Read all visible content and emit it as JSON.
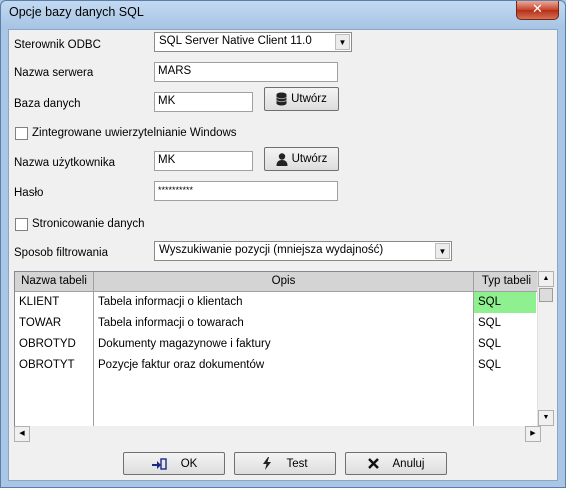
{
  "window": {
    "title": "Opcje bazy danych SQL",
    "close_glyph": "✕"
  },
  "form": {
    "driver_label": "Sterownik ODBC",
    "driver_value": "SQL Server Native Client 11.0",
    "server_label": "Nazwa serwera",
    "server_value": "MARS",
    "database_label": "Baza danych",
    "database_value": "MK",
    "create_db_label": "Utwórz",
    "integrated_auth_label": "Zintegrowane uwierzytelnianie Windows",
    "integrated_auth_checked": false,
    "username_label": "Nazwa użytkownika",
    "username_value": "MK",
    "create_user_label": "Utwórz",
    "password_label": "Hasło",
    "password_value": "**********",
    "paging_label": "Stronicowanie danych",
    "paging_checked": false,
    "filter_label": "Sposob filtrowania",
    "filter_value": "Wyszukiwanie pozycji (mniejsza wydajność)"
  },
  "table": {
    "columns": [
      "Nazwa tabeli",
      "Opis",
      "Typ tabeli"
    ],
    "rows": [
      {
        "name": "KLIENT",
        "desc": "Tabela informacji o klientach",
        "type": "SQL",
        "highlight_type": true
      },
      {
        "name": "TOWAR",
        "desc": "Tabela informacji o towarach",
        "type": "SQL",
        "highlight_type": false
      },
      {
        "name": "OBROTYD",
        "desc": "Dokumenty magazynowe i faktury",
        "type": "SQL",
        "highlight_type": false
      },
      {
        "name": "OBROTYT",
        "desc": "Pozycje faktur oraz dokumentów",
        "type": "SQL",
        "highlight_type": false
      }
    ]
  },
  "buttons": {
    "ok": "OK",
    "test": "Test",
    "cancel": "Anuluj"
  },
  "colors": {
    "highlight_cell": "#8ef08e",
    "header_bg": "#d4d4d4"
  }
}
